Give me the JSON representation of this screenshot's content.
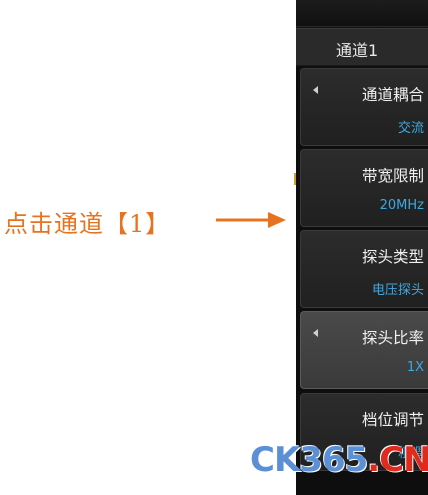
{
  "annotation": {
    "text": "点击通道【1】",
    "color": "#e8731e"
  },
  "panel": {
    "header": "通道1",
    "items": [
      {
        "label": "通道耦合",
        "value": "交流",
        "has_arrow": true
      },
      {
        "label": "带宽限制",
        "value": "20MHz",
        "has_arrow": false
      },
      {
        "label": "探头类型",
        "value": "电压探头",
        "has_arrow": false
      },
      {
        "label": "探头比率",
        "value": "1X",
        "has_arrow": true,
        "selected": true
      },
      {
        "label": "档位调节",
        "value": "粗调",
        "has_arrow": false
      }
    ],
    "value_color": "#3ea8e0"
  },
  "watermark": {
    "part1": "CK365",
    "dot": ".",
    "part2": "CN"
  },
  "icons": [
    "arrow-right-icon",
    "triangle-left-icon"
  ]
}
